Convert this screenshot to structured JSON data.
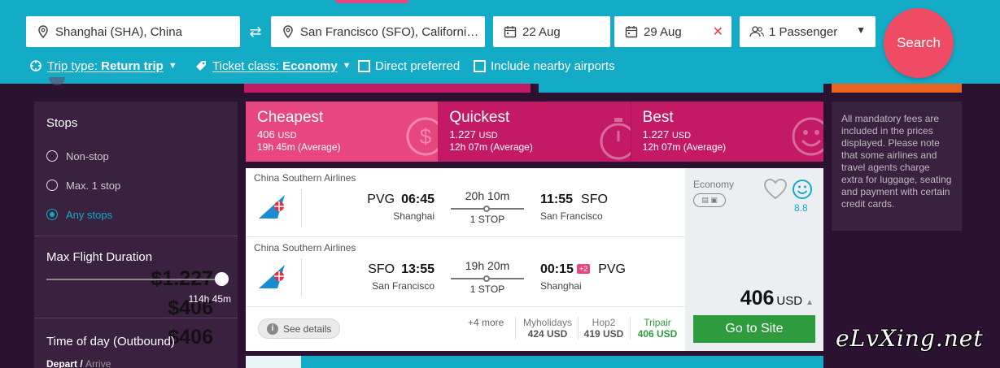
{
  "search": {
    "from": "Shanghai (SHA), China",
    "to": "San Francisco (SFO), California, ...",
    "depart_date": "22 Aug",
    "return_date": "29 Aug",
    "passengers": "1 Passenger",
    "search_label": "Search"
  },
  "options": {
    "trip_prefix": "Trip type: ",
    "trip_value": "Return trip",
    "class_prefix": "Ticket class: ",
    "class_value": "Economy",
    "direct": "Direct preferred",
    "nearby": "Include nearby airports"
  },
  "filters": {
    "stops_title": "Stops",
    "stops": [
      {
        "label": "Non-stop",
        "price": "$1.227"
      },
      {
        "label": "Max. 1 stop",
        "price": "$406"
      },
      {
        "label": "Any stops",
        "price": "$406"
      }
    ],
    "duration_title": "Max Flight Duration",
    "duration_value": "114h 45m",
    "time_title": "Time of day (Outbound)",
    "depart_label": "Depart",
    "arrive_label": "Arrive",
    "separator": "/"
  },
  "tabs": [
    {
      "title": "Cheapest",
      "price": "406",
      "currency": "USD",
      "duration": "19h 45m (Average)"
    },
    {
      "title": "Quickest",
      "price": "1.227",
      "currency": "USD",
      "duration": "12h 07m (Average)"
    },
    {
      "title": "Best",
      "price": "1.227",
      "currency": "USD",
      "duration": "12h 07m (Average)"
    }
  ],
  "result": {
    "outbound": {
      "airline": "China Southern Airlines",
      "dep_code": "PVG",
      "dep_time": "06:45",
      "dep_city": "Shanghai",
      "duration": "20h 10m",
      "stops": "1 STOP",
      "arr_time": "11:55",
      "arr_code": "SFO",
      "arr_city": "San Francisco"
    },
    "inbound": {
      "airline": "China Southern Airlines",
      "dep_code": "SFO",
      "dep_time": "13:55",
      "dep_city": "San Francisco",
      "duration": "19h 20m",
      "stops": "1 STOP",
      "arr_time": "00:15",
      "day_offset": "+2",
      "arr_code": "PVG",
      "arr_city": "Shanghai"
    },
    "see_details": "See details",
    "more": "+4 more",
    "vendors": [
      {
        "name": "Myholidays",
        "price": "424 USD"
      },
      {
        "name": "Hop2",
        "price": "419 USD"
      },
      {
        "name": "Tripair",
        "price": "406 USD"
      }
    ],
    "cabin": "Economy",
    "score": "8.8",
    "price": "406",
    "currency": "USD",
    "goto_label": "Go to Site"
  },
  "info_text": "All mandatory fees are included in the prices displayed. Please note that some airlines and travel agents charge extra for luggage, seating and payment with certain credit cards.",
  "watermark": "eLvXing.net",
  "colors": {
    "bar": "#13abc6",
    "pink": "#e8467f",
    "magenta": "#c41a66",
    "search": "#f04b64",
    "green": "#2e9c3e",
    "panel": "#3a2140"
  }
}
